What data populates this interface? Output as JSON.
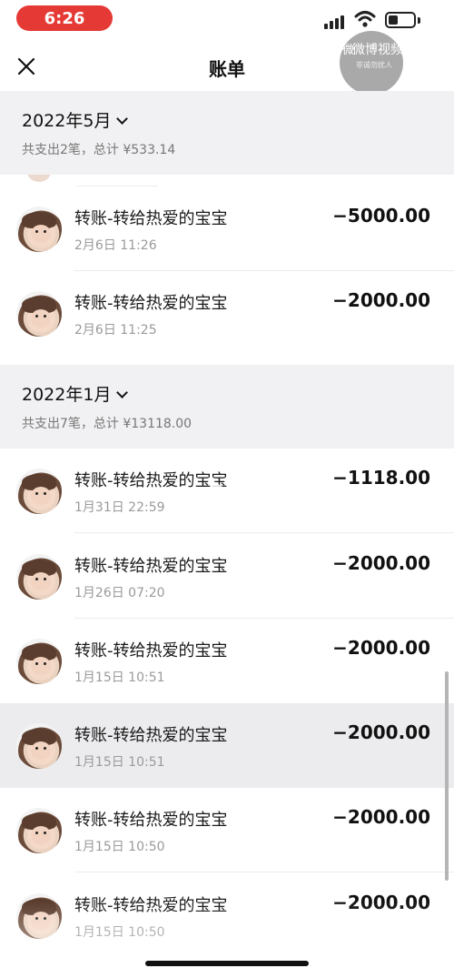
{
  "status_bar": {
    "time": "6:26"
  },
  "watermark": {
    "text": "微博视频",
    "sub": "非诚勿扰人",
    "logo": "微"
  },
  "nav": {
    "title": "账单",
    "close_icon": "close-icon"
  },
  "months": [
    {
      "title": "2022年5月",
      "summary": "共支出2笔，总计 ¥533.14",
      "items": [
        {
          "title": "转账-转给热爱的宝宝",
          "time": "2月6日 11:26",
          "amount": "−5000.00"
        },
        {
          "title": "转账-转给热爱的宝宝",
          "time": "2月6日 11:25",
          "amount": "−2000.00"
        }
      ]
    },
    {
      "title": "2022年1月",
      "summary": "共支出7笔，总计 ¥13118.00",
      "items": [
        {
          "title": "转账-转给热爱的宝宝",
          "time": "1月31日 22:59",
          "amount": "−1118.00"
        },
        {
          "title": "转账-转给热爱的宝宝",
          "time": "1月26日 07:20",
          "amount": "−2000.00"
        },
        {
          "title": "转账-转给热爱的宝宝",
          "time": "1月15日 10:51",
          "amount": "−2000.00"
        },
        {
          "title": "转账-转给热爱的宝宝",
          "time": "1月15日 10:51",
          "amount": "−2000.00"
        },
        {
          "title": "转账-转给热爱的宝宝",
          "time": "1月15日 10:50",
          "amount": "−2000.00"
        },
        {
          "title": "转账-转给热爱的宝宝",
          "time": "1月15日 10:50",
          "amount": "−2000.00"
        }
      ]
    }
  ],
  "colors": {
    "time_pill": "#e53935",
    "section_bg": "#f1f1f3",
    "highlight_row": "#ececef"
  }
}
